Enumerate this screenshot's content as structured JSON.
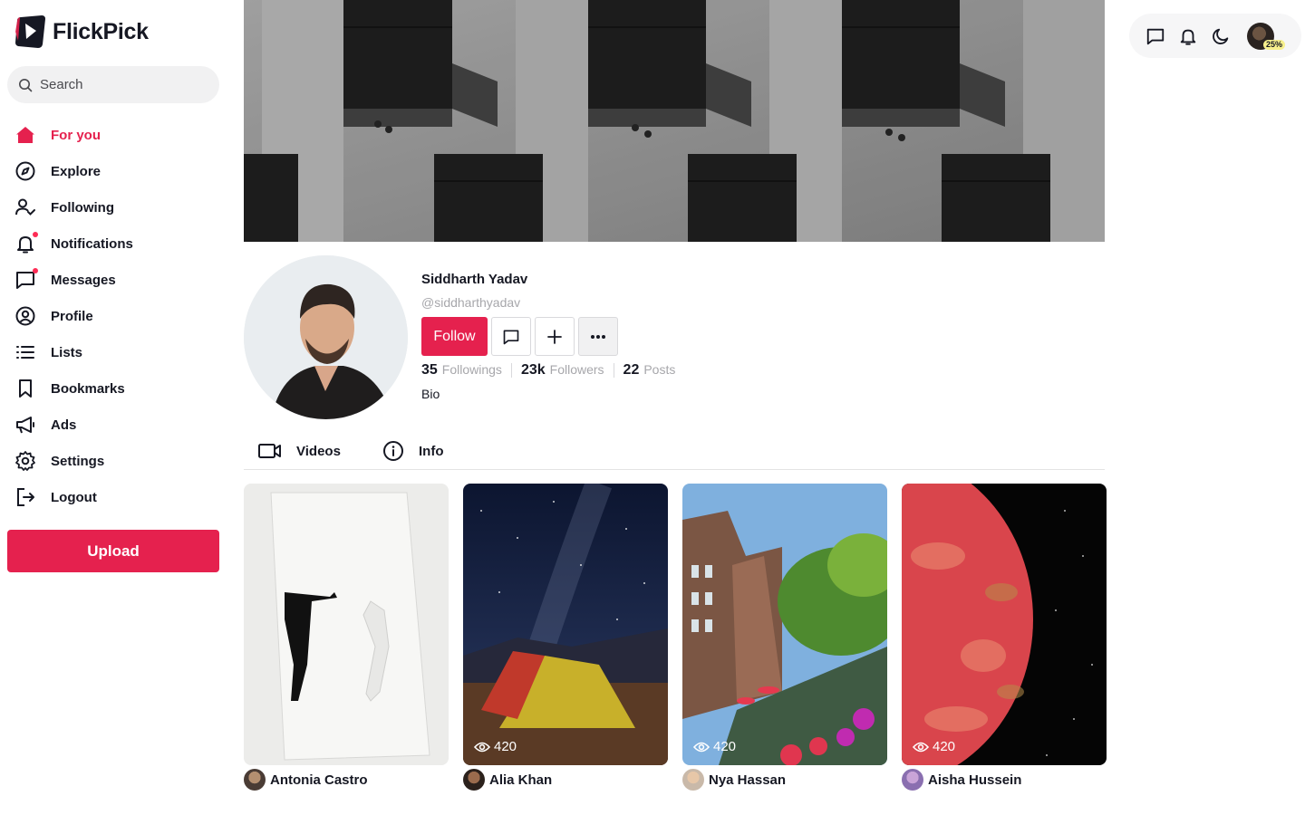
{
  "app": {
    "name": "FlickPick"
  },
  "search": {
    "placeholder": "Search"
  },
  "nav": {
    "items": [
      {
        "label": "For you",
        "icon": "home-icon",
        "active": true
      },
      {
        "label": "Explore",
        "icon": "compass-icon"
      },
      {
        "label": "Following",
        "icon": "user-check-icon"
      },
      {
        "label": "Notifications",
        "icon": "bell-icon",
        "badge": true
      },
      {
        "label": "Messages",
        "icon": "message-icon",
        "badge": true
      },
      {
        "label": "Profile",
        "icon": "user-circle-icon"
      },
      {
        "label": "Lists",
        "icon": "list-icon"
      },
      {
        "label": "Bookmarks",
        "icon": "bookmark-icon"
      },
      {
        "label": "Ads",
        "icon": "megaphone-icon"
      },
      {
        "label": "Settings",
        "icon": "gear-icon"
      },
      {
        "label": "Logout",
        "icon": "logout-icon"
      }
    ],
    "upload_label": "Upload"
  },
  "toolbar": {
    "avatar_badge": "25%"
  },
  "profile": {
    "name": "Siddharth Yadav",
    "handle": "@siddharthyadav",
    "follow_label": "Follow",
    "stats": [
      {
        "value": "35",
        "label": "Followings"
      },
      {
        "value": "23k",
        "label": "Followers"
      },
      {
        "value": "22",
        "label": "Posts"
      }
    ],
    "bio": "Bio"
  },
  "tabs": [
    {
      "label": "Videos",
      "icon": "video-icon"
    },
    {
      "label": "Info",
      "icon": "info-icon"
    }
  ],
  "videos": [
    {
      "author": "Antonia Castro",
      "views": ""
    },
    {
      "author": "Alia Khan",
      "views": "420"
    },
    {
      "author": "Nya Hassan",
      "views": "420"
    },
    {
      "author": "Aisha Hussein",
      "views": "420"
    }
  ],
  "colors": {
    "accent": "#e5214e",
    "text": "#161823",
    "muted": "#a7a7ab"
  }
}
